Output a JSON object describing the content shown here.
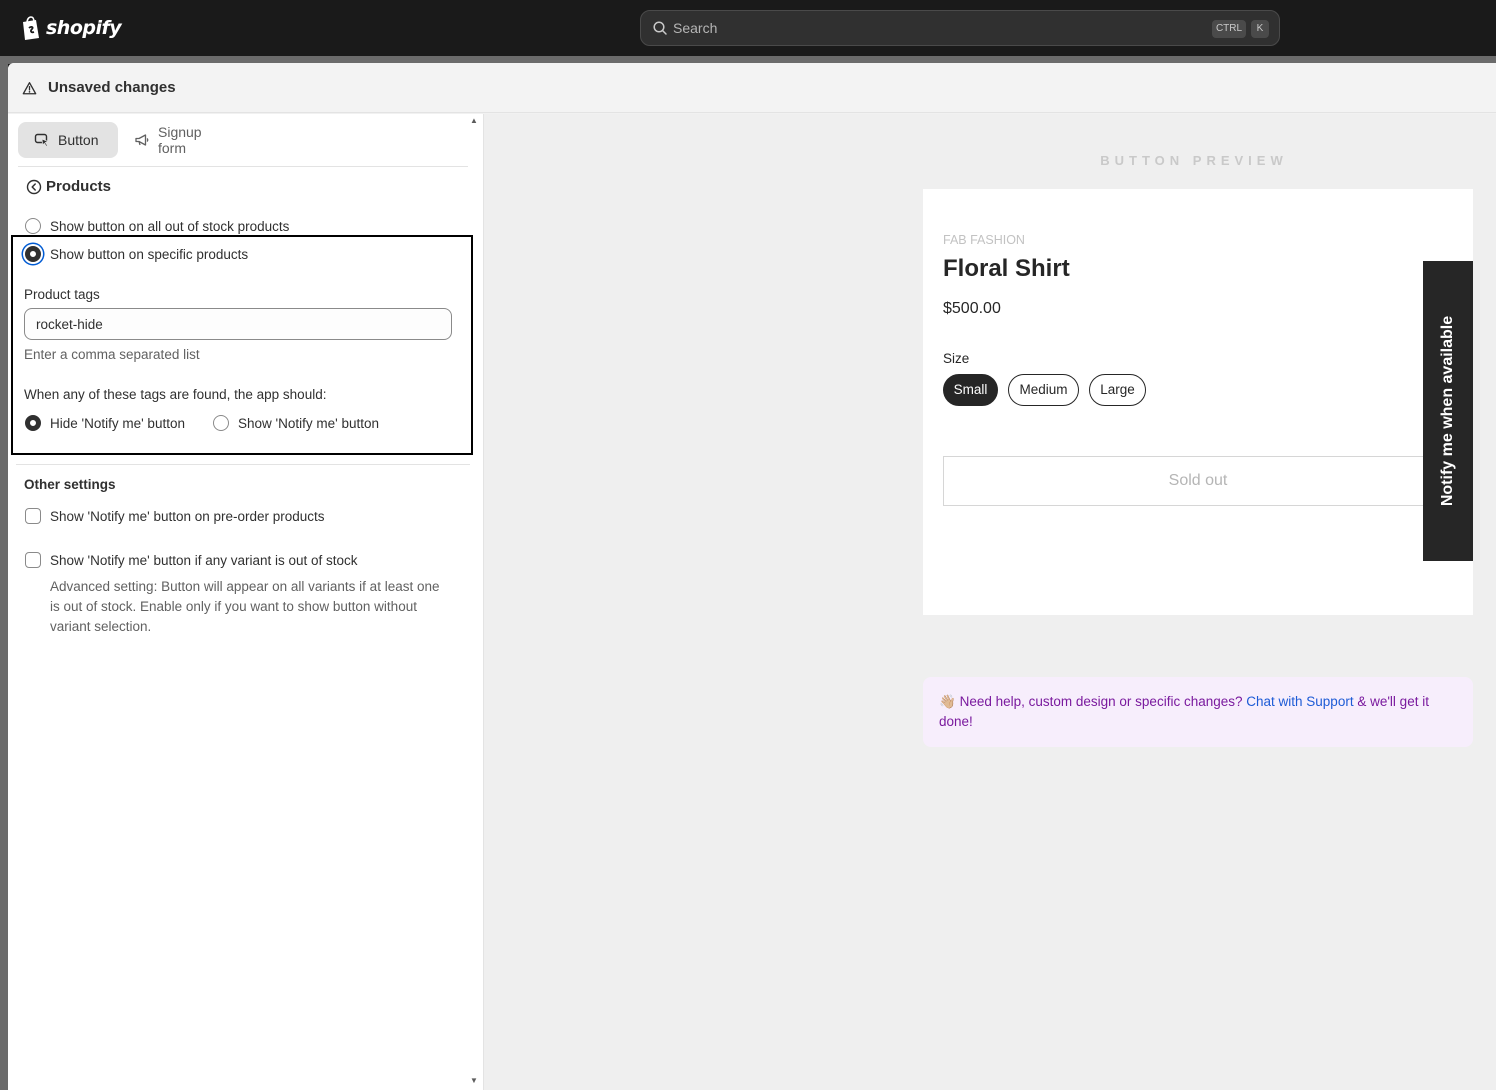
{
  "topbar": {
    "logo_text": "shopify",
    "search_placeholder": "Search",
    "shortcut_ctrl": "CTRL",
    "shortcut_k": "K"
  },
  "save_bar": {
    "text": "Unsaved changes"
  },
  "tabs": [
    {
      "label": "Button",
      "selected": true
    },
    {
      "label": "Signup form",
      "selected": false
    }
  ],
  "products_section": {
    "back_label": "Products",
    "option_all": "Show button on all out of stock products",
    "option_specific": "Show button on specific products",
    "selected_option": "specific",
    "tags_label": "Product tags",
    "tags_value": "rocket-hide",
    "tags_help": "Enter a comma separated list",
    "when_text": "When any of these tags are found, the app should:",
    "hide_label": "Hide 'Notify me' button",
    "show_label": "Show 'Notify me' button",
    "tag_action": "hide"
  },
  "other_settings": {
    "title": "Other settings",
    "preorder_label": "Show 'Notify me' button on pre-order products",
    "preorder_checked": false,
    "variant_label": "Show 'Notify me' button if any variant is out of stock",
    "variant_checked": false,
    "variant_help": "Advanced setting: Button will appear on all variants if at least one is out of stock. Enable only if you want to show button without variant selection."
  },
  "preview": {
    "title": "BUTTON PREVIEW",
    "vendor": "FAB FASHION",
    "product_title": "Floral Shirt",
    "price": "$500.00",
    "size_label": "Size",
    "sizes": [
      "Small",
      "Medium",
      "Large"
    ],
    "selected_size": "Small",
    "sold_out_label": "Sold out",
    "notify_tab_label": "Notify me when available"
  },
  "help_banner": {
    "emoji": "👋🏼",
    "text_before": "Need help, custom design or specific changes?",
    "link_text": "Chat with Support",
    "text_after": "& we'll get it done!"
  },
  "colors": {
    "topbar_bg": "#1a1a1a",
    "accent_focus": "#005bd3",
    "preview_dark": "#262626",
    "help_text": "#7a1a9e",
    "help_bg": "#f7eefc",
    "link": "#1d5bd6"
  }
}
